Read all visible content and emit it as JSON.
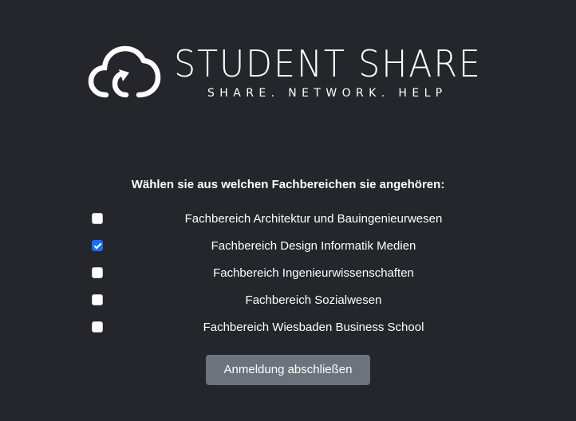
{
  "logo": {
    "icon": "cloud-upload-icon",
    "title": "STUDENT SHARE",
    "tagline": "SHARE. NETWORK. HELP"
  },
  "form": {
    "prompt": "Wählen sie aus welchen Fachbereichen sie angehören:",
    "options": [
      {
        "label": "Fachbereich Architektur und Bauingenieurwesen",
        "checked": false
      },
      {
        "label": "Fachbereich Design Informatik Medien",
        "checked": true
      },
      {
        "label": "Fachbereich Ingenieurwissenschaften",
        "checked": false
      },
      {
        "label": "Fachbereich Sozialwesen",
        "checked": false
      },
      {
        "label": "Fachbereich Wiesbaden Business School",
        "checked": false
      }
    ],
    "submit_label": "Anmeldung abschließen"
  },
  "colors": {
    "background": "#24262c",
    "checked": "#1a6ef5",
    "button": "#6c737c"
  }
}
